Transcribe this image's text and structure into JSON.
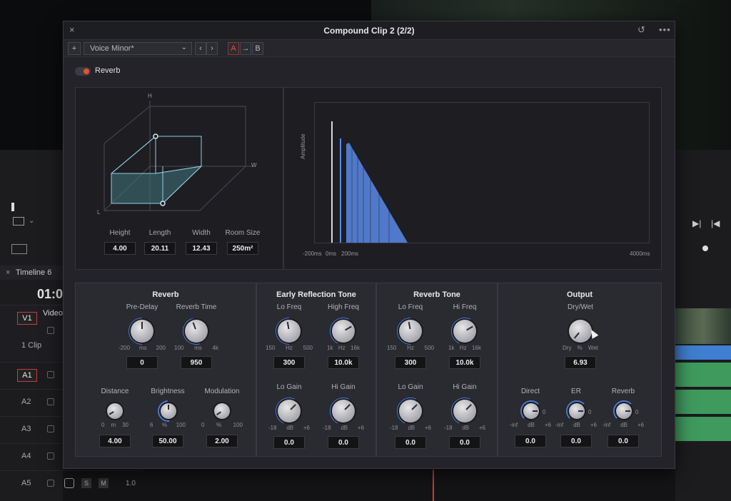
{
  "host": {
    "timeline_tab": "Timeline 6",
    "timecode": "01:0",
    "video_track": {
      "badge": "V1",
      "name": "Video",
      "clip_count": "1 Clip"
    },
    "audio_tracks": [
      "A1",
      "A2",
      "A3",
      "A4",
      "A5"
    ],
    "a5_controls": {
      "solo": "S",
      "mute": "M",
      "level": "1.0"
    }
  },
  "dialog": {
    "title": "Compound Clip 2 (2/2)",
    "add_label": "+",
    "preset": "Voice Minor*",
    "ab": {
      "a": "A",
      "arrow": "→",
      "b": "B"
    }
  },
  "plugin": {
    "name": "Reverb",
    "enabled": true
  },
  "room": {
    "axes": {
      "h": "H",
      "w": "W",
      "l": "L"
    },
    "params": [
      {
        "label": "Height",
        "value": "4.00"
      },
      {
        "label": "Length",
        "value": "20.11"
      },
      {
        "label": "Width",
        "value": "12.43"
      },
      {
        "label": "Room Size",
        "value": "250m²"
      }
    ]
  },
  "impulse": {
    "y_label": "Amplitude",
    "x_ticks": [
      "-200ms",
      "0ms",
      "200ms",
      "4000ms"
    ]
  },
  "sections": {
    "reverb": {
      "title": "Reverb",
      "pre_delay": {
        "label": "Pre-Delay",
        "scale": [
          "-200",
          "ms",
          "200"
        ],
        "value": "0"
      },
      "reverb_time": {
        "label": "Reverb Time",
        "scale": [
          "100",
          "ms",
          "4k"
        ],
        "value": "950"
      },
      "distance": {
        "label": "Distance",
        "scale": [
          "0",
          "m",
          "30"
        ],
        "value": "4.00"
      },
      "brightness": {
        "label": "Brightness",
        "scale": [
          "6",
          "%",
          "100"
        ],
        "value": "50.00"
      },
      "modulation": {
        "label": "Modulation",
        "scale": [
          "0",
          "%",
          "100"
        ],
        "value": "2.00"
      }
    },
    "early_reflection": {
      "title": "Early Reflection Tone",
      "lo_freq": {
        "label": "Lo Freq",
        "scale": [
          "150",
          "Hz",
          "500"
        ],
        "value": "300"
      },
      "hi_freq": {
        "label": "High Freq",
        "scale": [
          "1k",
          "Hz",
          "16k"
        ],
        "value": "10.0k"
      },
      "lo_gain": {
        "label": "Lo Gain",
        "scale": [
          "-18",
          "dB",
          "+6"
        ],
        "value": "0.0"
      },
      "hi_gain": {
        "label": "Hi Gain",
        "scale": [
          "-18",
          "dB",
          "+6"
        ],
        "value": "0.0"
      }
    },
    "reverb_tone": {
      "title": "Reverb Tone",
      "lo_freq": {
        "label": "Lo Freq",
        "scale": [
          "150",
          "Hz",
          "500"
        ],
        "value": "300"
      },
      "hi_freq": {
        "label": "Hi Freq",
        "scale": [
          "1k",
          "Hz",
          "16k"
        ],
        "value": "10.0k"
      },
      "lo_gain": {
        "label": "Lo Gain",
        "scale": [
          "-18",
          "dB",
          "+6"
        ],
        "value": "0.0"
      },
      "hi_gain": {
        "label": "Hi Gain",
        "scale": [
          "-18",
          "dB",
          "+6"
        ],
        "value": "0.0"
      }
    },
    "output": {
      "title": "Output",
      "dry_wet": {
        "label": "Dry/Wet",
        "scale": [
          "Dry",
          "%",
          "Wet"
        ],
        "value": "6.93"
      },
      "direct": {
        "label": "Direct",
        "scale": [
          "-inf",
          "dB",
          "+6"
        ],
        "zero": "0",
        "value": "0.0"
      },
      "er": {
        "label": "ER",
        "scale": [
          "-inf",
          "dB",
          "+6"
        ],
        "zero": "0",
        "value": "0.0"
      },
      "reverb": {
        "label": "Reverb",
        "scale": [
          "-inf",
          "dB",
          "+6"
        ],
        "zero": "0",
        "value": "0.0"
      }
    }
  },
  "colors": {
    "accent": "#4a7ad6",
    "toggle_on": "#e8503a",
    "record_red": "#c04040"
  }
}
